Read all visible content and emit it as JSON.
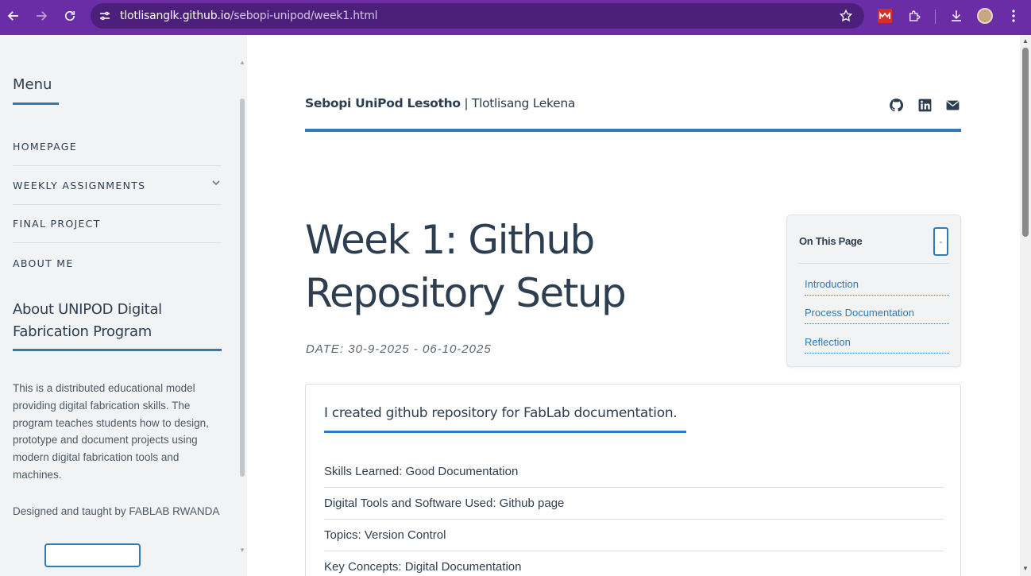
{
  "browser": {
    "url_host": "tlotlisanglk.github.io",
    "url_path": "/sebopi-unipod/week1.html"
  },
  "sidebar": {
    "menu_title": "Menu",
    "items": [
      {
        "label": "HOMEPAGE"
      },
      {
        "label": "WEEKLY ASSIGNMENTS"
      },
      {
        "label": "FINAL PROJECT"
      },
      {
        "label": "ABOUT ME"
      }
    ],
    "about_title": "About UNIPOD Digital Fabrication Program",
    "about_text": "This is a distributed educational model providing digital fabrication skills. The program teaches students how to design, prototype and document projects using modern digital fabrication tools and machines.",
    "designed_by": "Designed and taught by FABLAB RWANDA"
  },
  "header": {
    "site_name": "Sebopi UniPod Lesotho",
    "separator": " | ",
    "author": "Tlotlisang Lekena"
  },
  "main": {
    "title": "Week 1: Github Repository Setup",
    "date": "DATE: 30-9-2025 - 06-10-2025",
    "toc": {
      "title": "On This Page",
      "toggle": "-",
      "links": [
        "Introduction",
        "Process Documentation",
        "Reflection"
      ]
    },
    "card": {
      "lead": "I created github repository for FabLab documentation.",
      "rows": [
        "Skills Learned: Good Documentation",
        "Digital Tools and Software Used: Github page",
        "Topics: Version Control",
        "Key Concepts: Digital Documentation"
      ]
    }
  },
  "colors": {
    "chrome": "#6a2da6",
    "accent": "#2f7ab8",
    "text": "#2d3e50",
    "sidebar_bg": "#f1f3f4"
  },
  "icons": [
    "back-icon",
    "forward-icon",
    "reload-icon",
    "site-settings-icon",
    "bookmark-star-icon",
    "extension-icon",
    "puzzle-icon",
    "download-icon",
    "profile-avatar",
    "kebab-menu-icon",
    "github-icon",
    "linkedin-icon",
    "envelope-icon",
    "chevron-down-icon"
  ]
}
